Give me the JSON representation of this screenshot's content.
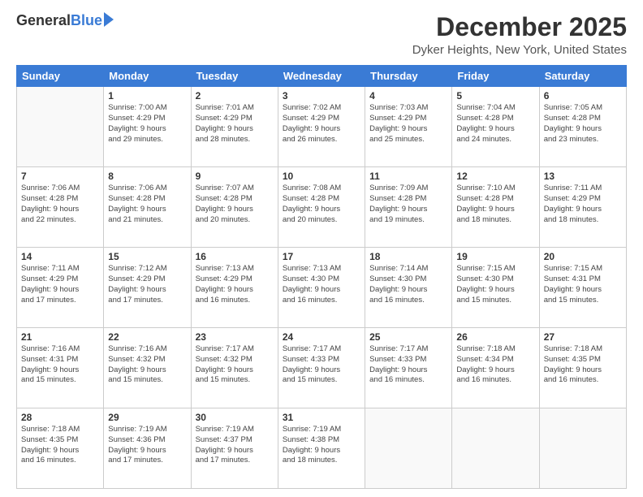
{
  "header": {
    "logo_general": "General",
    "logo_blue": "Blue",
    "main_title": "December 2025",
    "sub_title": "Dyker Heights, New York, United States"
  },
  "days_of_week": [
    "Sunday",
    "Monday",
    "Tuesday",
    "Wednesday",
    "Thursday",
    "Friday",
    "Saturday"
  ],
  "weeks": [
    [
      {
        "day": "",
        "info": ""
      },
      {
        "day": "1",
        "info": "Sunrise: 7:00 AM\nSunset: 4:29 PM\nDaylight: 9 hours\nand 29 minutes."
      },
      {
        "day": "2",
        "info": "Sunrise: 7:01 AM\nSunset: 4:29 PM\nDaylight: 9 hours\nand 28 minutes."
      },
      {
        "day": "3",
        "info": "Sunrise: 7:02 AM\nSunset: 4:29 PM\nDaylight: 9 hours\nand 26 minutes."
      },
      {
        "day": "4",
        "info": "Sunrise: 7:03 AM\nSunset: 4:29 PM\nDaylight: 9 hours\nand 25 minutes."
      },
      {
        "day": "5",
        "info": "Sunrise: 7:04 AM\nSunset: 4:28 PM\nDaylight: 9 hours\nand 24 minutes."
      },
      {
        "day": "6",
        "info": "Sunrise: 7:05 AM\nSunset: 4:28 PM\nDaylight: 9 hours\nand 23 minutes."
      }
    ],
    [
      {
        "day": "7",
        "info": "Sunrise: 7:06 AM\nSunset: 4:28 PM\nDaylight: 9 hours\nand 22 minutes."
      },
      {
        "day": "8",
        "info": "Sunrise: 7:06 AM\nSunset: 4:28 PM\nDaylight: 9 hours\nand 21 minutes."
      },
      {
        "day": "9",
        "info": "Sunrise: 7:07 AM\nSunset: 4:28 PM\nDaylight: 9 hours\nand 20 minutes."
      },
      {
        "day": "10",
        "info": "Sunrise: 7:08 AM\nSunset: 4:28 PM\nDaylight: 9 hours\nand 20 minutes."
      },
      {
        "day": "11",
        "info": "Sunrise: 7:09 AM\nSunset: 4:28 PM\nDaylight: 9 hours\nand 19 minutes."
      },
      {
        "day": "12",
        "info": "Sunrise: 7:10 AM\nSunset: 4:28 PM\nDaylight: 9 hours\nand 18 minutes."
      },
      {
        "day": "13",
        "info": "Sunrise: 7:11 AM\nSunset: 4:29 PM\nDaylight: 9 hours\nand 18 minutes."
      }
    ],
    [
      {
        "day": "14",
        "info": "Sunrise: 7:11 AM\nSunset: 4:29 PM\nDaylight: 9 hours\nand 17 minutes."
      },
      {
        "day": "15",
        "info": "Sunrise: 7:12 AM\nSunset: 4:29 PM\nDaylight: 9 hours\nand 17 minutes."
      },
      {
        "day": "16",
        "info": "Sunrise: 7:13 AM\nSunset: 4:29 PM\nDaylight: 9 hours\nand 16 minutes."
      },
      {
        "day": "17",
        "info": "Sunrise: 7:13 AM\nSunset: 4:30 PM\nDaylight: 9 hours\nand 16 minutes."
      },
      {
        "day": "18",
        "info": "Sunrise: 7:14 AM\nSunset: 4:30 PM\nDaylight: 9 hours\nand 16 minutes."
      },
      {
        "day": "19",
        "info": "Sunrise: 7:15 AM\nSunset: 4:30 PM\nDaylight: 9 hours\nand 15 minutes."
      },
      {
        "day": "20",
        "info": "Sunrise: 7:15 AM\nSunset: 4:31 PM\nDaylight: 9 hours\nand 15 minutes."
      }
    ],
    [
      {
        "day": "21",
        "info": "Sunrise: 7:16 AM\nSunset: 4:31 PM\nDaylight: 9 hours\nand 15 minutes."
      },
      {
        "day": "22",
        "info": "Sunrise: 7:16 AM\nSunset: 4:32 PM\nDaylight: 9 hours\nand 15 minutes."
      },
      {
        "day": "23",
        "info": "Sunrise: 7:17 AM\nSunset: 4:32 PM\nDaylight: 9 hours\nand 15 minutes."
      },
      {
        "day": "24",
        "info": "Sunrise: 7:17 AM\nSunset: 4:33 PM\nDaylight: 9 hours\nand 15 minutes."
      },
      {
        "day": "25",
        "info": "Sunrise: 7:17 AM\nSunset: 4:33 PM\nDaylight: 9 hours\nand 16 minutes."
      },
      {
        "day": "26",
        "info": "Sunrise: 7:18 AM\nSunset: 4:34 PM\nDaylight: 9 hours\nand 16 minutes."
      },
      {
        "day": "27",
        "info": "Sunrise: 7:18 AM\nSunset: 4:35 PM\nDaylight: 9 hours\nand 16 minutes."
      }
    ],
    [
      {
        "day": "28",
        "info": "Sunrise: 7:18 AM\nSunset: 4:35 PM\nDaylight: 9 hours\nand 16 minutes."
      },
      {
        "day": "29",
        "info": "Sunrise: 7:19 AM\nSunset: 4:36 PM\nDaylight: 9 hours\nand 17 minutes."
      },
      {
        "day": "30",
        "info": "Sunrise: 7:19 AM\nSunset: 4:37 PM\nDaylight: 9 hours\nand 17 minutes."
      },
      {
        "day": "31",
        "info": "Sunrise: 7:19 AM\nSunset: 4:38 PM\nDaylight: 9 hours\nand 18 minutes."
      },
      {
        "day": "",
        "info": ""
      },
      {
        "day": "",
        "info": ""
      },
      {
        "day": "",
        "info": ""
      }
    ]
  ]
}
